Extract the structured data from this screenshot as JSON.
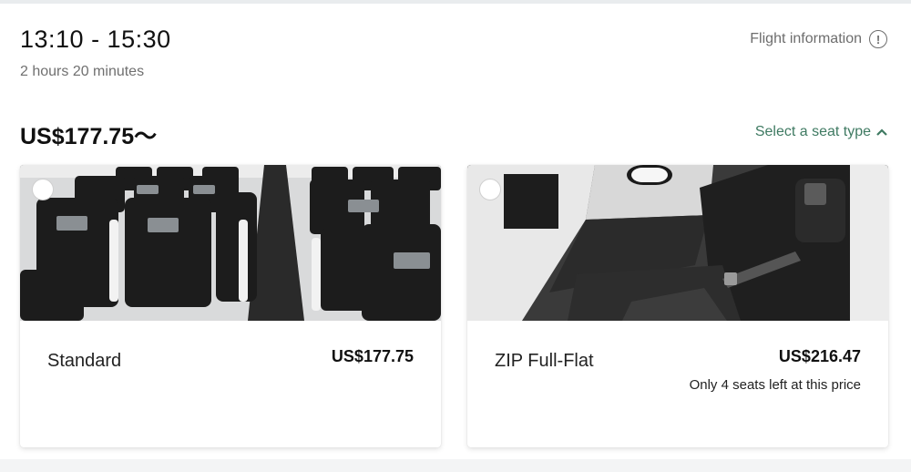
{
  "flight": {
    "time_range": "13:10 - 15:30",
    "duration": "2 hours 20 minutes",
    "info_link": "Flight information",
    "info_icon": "info-circle-icon",
    "price_from": "US$177.75〜",
    "select_seat_label": "Select a seat type",
    "select_seat_icon": "chevron-up-icon"
  },
  "options": [
    {
      "name": "Standard",
      "price": "US$177.75",
      "note": ""
    },
    {
      "name": "ZIP Full-Flat",
      "price": "US$216.47",
      "note": "Only 4 seats left at this price"
    }
  ],
  "colors": {
    "accent": "#3f7a62",
    "muted_text": "#6d6d6d"
  }
}
